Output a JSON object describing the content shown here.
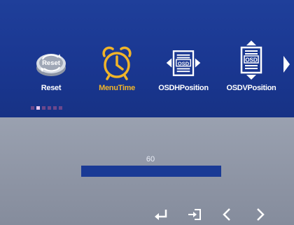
{
  "osd": {
    "menu_items": [
      {
        "label": "Reset",
        "icon": "reset-icon"
      },
      {
        "label": "MenuTime",
        "icon": "alarm-clock-icon",
        "selected": true
      },
      {
        "label": "OSDHPosition",
        "icon": "osd-horizontal-position-icon"
      },
      {
        "label": "OSDVPosition",
        "icon": "osd-vertical-position-icon"
      }
    ],
    "reset_badge_text": "Reset",
    "osd_badge_text": "OSD",
    "page_indicator": {
      "count": 6,
      "active_index": 1
    },
    "slider": {
      "value": "60",
      "fill_fraction": 1.0
    },
    "nav_icons": [
      "enter-icon",
      "exit-icon",
      "left-arrow-icon",
      "right-arrow-icon"
    ],
    "colors": {
      "panel_blue": "#1f3f9a",
      "selected_gold": "#f0b42a",
      "bar_blue": "#1a3a95",
      "panel_gray": "#9aa1b0"
    }
  }
}
